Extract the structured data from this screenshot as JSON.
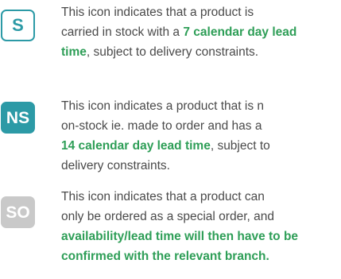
{
  "colors": {
    "teal": "#2c9aa6",
    "green_highlight": "#2e9e57",
    "grey_badge": "#c9c9c9",
    "body_text": "#4a4a4a"
  },
  "legend": {
    "items": [
      {
        "badge": "S",
        "lines": [
          [
            "This icon indicates that a product is",
            ""
          ],
          [
            "carried in stock with a ",
            "7 calendar day lead"
          ],
          [
            "",
            "time",
            ", subject to delivery constraints."
          ]
        ]
      },
      {
        "badge": "NS",
        "lines": [
          [
            "This icon indicates a product that is n",
            ""
          ],
          [
            "on-stock ie. made to order and has a",
            ""
          ],
          [
            "",
            "14 calendar day lead time",
            ", subject to"
          ],
          [
            "delivery constraints.",
            ""
          ]
        ]
      },
      {
        "badge": "SO",
        "lines": [
          [
            "This icon indicates that a product can",
            ""
          ],
          [
            "only be ordered as a special order, and",
            ""
          ],
          [
            "",
            "availability/lead time will then have to be"
          ],
          [
            "",
            "confirmed with the relevant branch."
          ]
        ]
      }
    ]
  }
}
